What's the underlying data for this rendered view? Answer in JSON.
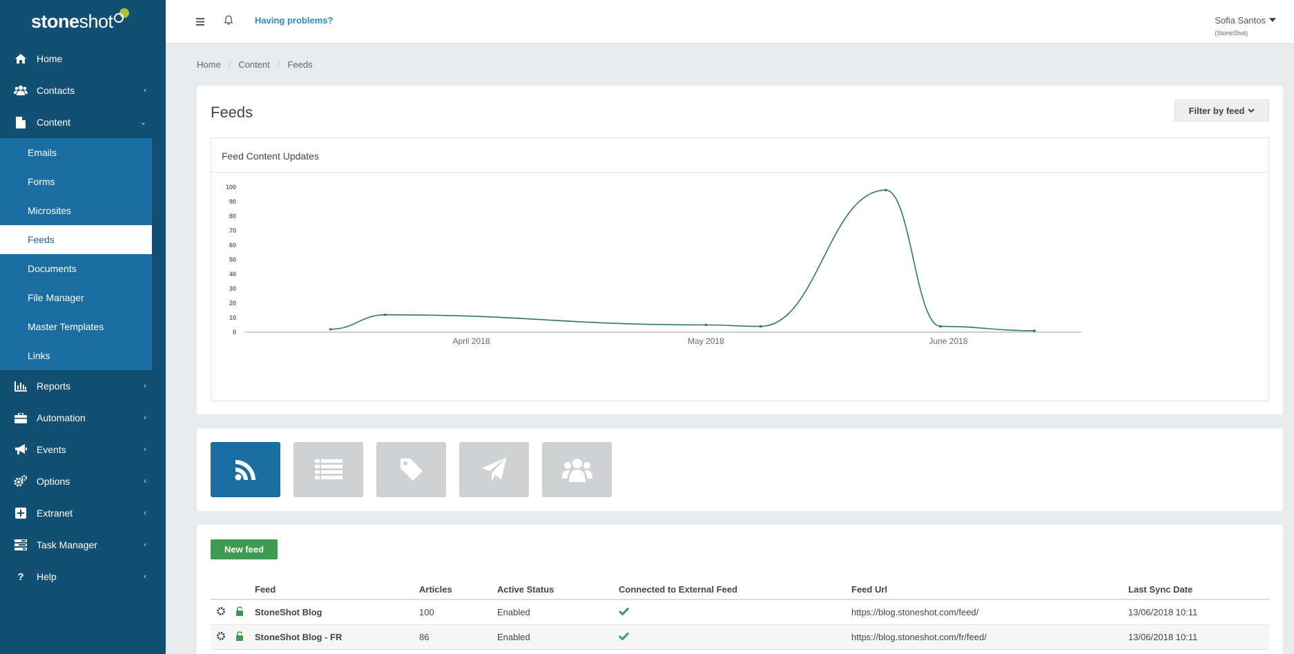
{
  "brand": {
    "logo_bold": "stone",
    "logo_light": "shot"
  },
  "topbar": {
    "help_text": "Having problems?",
    "user_name": "Sofia Santos",
    "user_org": "(StoneShot)"
  },
  "sidebar": {
    "items": [
      {
        "label": "Home",
        "icon": "home-icon"
      },
      {
        "label": "Contacts",
        "icon": "users-icon"
      },
      {
        "label": "Content",
        "icon": "file-icon"
      },
      {
        "label": "Reports",
        "icon": "bar-chart-icon"
      },
      {
        "label": "Automation",
        "icon": "briefcase-icon"
      },
      {
        "label": "Events",
        "icon": "megaphone-icon"
      },
      {
        "label": "Options",
        "icon": "gears-icon"
      },
      {
        "label": "Extranet",
        "icon": "plus-square-icon"
      },
      {
        "label": "Task Manager",
        "icon": "tasks-icon"
      },
      {
        "label": "Help",
        "icon": "question-icon"
      }
    ],
    "content_submenu": [
      "Emails",
      "Forms",
      "Microsites",
      "Feeds",
      "Documents",
      "File Manager",
      "Master Templates",
      "Links"
    ],
    "active_sub": "Feeds"
  },
  "breadcrumb": [
    "Home",
    "Content",
    "Feeds"
  ],
  "page": {
    "title": "Feeds",
    "filter_label": "Filter by feed"
  },
  "chart_data": {
    "type": "line",
    "title": "Feed Content Updates",
    "x": [
      "2018-03-14",
      "2018-03-21",
      "2018-05-01",
      "2018-05-08",
      "2018-05-24",
      "2018-05-31",
      "2018-06-12"
    ],
    "x_tick_labels": [
      "April 2018",
      "May 2018",
      "June 2018"
    ],
    "values": [
      2,
      12,
      5,
      4,
      98,
      4,
      1
    ],
    "ylim": [
      0,
      100
    ],
    "y_ticks": [
      0,
      10,
      20,
      30,
      40,
      50,
      60,
      70,
      80,
      90,
      100
    ],
    "color": "#2e7a5a",
    "grid": false
  },
  "tiles": [
    {
      "icon": "rss-icon",
      "active": true
    },
    {
      "icon": "list-icon",
      "active": false
    },
    {
      "icon": "tag-icon",
      "active": false
    },
    {
      "icon": "paper-plane-icon",
      "active": false
    },
    {
      "icon": "group-icon",
      "active": false
    }
  ],
  "feeds_table": {
    "new_button": "New feed",
    "columns": [
      "Feed",
      "Articles",
      "Active Status",
      "Connected to External Feed",
      "Feed Url",
      "Last Sync Date"
    ],
    "rows": [
      {
        "name": "StoneShot Blog",
        "articles": "100",
        "status": "Enabled",
        "connected": true,
        "url": "https://blog.stoneshot.com/feed/",
        "last_sync": "13/06/2018 10:11"
      },
      {
        "name": "StoneShot Blog - FR",
        "articles": "86",
        "status": "Enabled",
        "connected": true,
        "url": "https://blog.stoneshot.com/fr/feed/",
        "last_sync": "13/06/2018 10:11"
      }
    ]
  },
  "colors": {
    "sidebar": "#134f73",
    "submenu": "#1b6da1",
    "accent": "#2f8ac4",
    "success": "#3f9a51"
  }
}
